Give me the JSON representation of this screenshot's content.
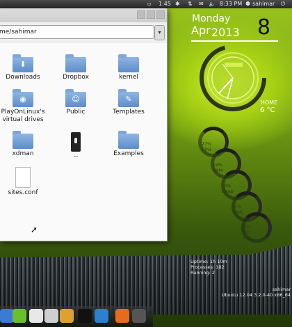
{
  "panel": {
    "time1": "1:45",
    "clock": "8:33 PM",
    "user": "sahimar"
  },
  "window": {
    "address": "me/sahimar",
    "dropdown": "▾",
    "items": [
      {
        "label": "Downloads",
        "icon": "downloads-folder-icon"
      },
      {
        "label": "Dropbox",
        "icon": "folder-icon"
      },
      {
        "label": "kernel",
        "icon": "folder-icon"
      },
      {
        "label": "PlayOnLinux's virtual drives",
        "icon": "playonlinux-folder-icon"
      },
      {
        "label": "Public",
        "icon": "public-folder-icon"
      },
      {
        "label": "Templates",
        "icon": "templates-folder-icon"
      },
      {
        "label": "xdman",
        "icon": "folder-icon"
      },
      {
        "label": "--",
        "icon": "lock-file-icon"
      },
      {
        "label": "Examples",
        "icon": "folder-icon"
      },
      {
        "label": "sites.conf",
        "icon": "text-file-icon"
      }
    ]
  },
  "widget": {
    "day": "Monday",
    "month": "Apr",
    "year": "2013",
    "date": "8",
    "location": "HOME",
    "temp": "6 °C",
    "gauges": [
      {
        "value": "27%",
        "name": "CPU"
      },
      {
        "value": "19%",
        "name": "RAM"
      },
      {
        "value": "0%",
        "name": "Swap"
      },
      {
        "value": "5%",
        "name": "Disk"
      },
      {
        "value": "0D",
        "name": "0U"
      },
      {
        "value": "Net",
        "name": ""
      }
    ],
    "stats_left": [
      "Uptime: 1h 10m",
      "Processes: 182",
      "Running: 2"
    ],
    "stats_right": [
      "sahimar",
      "Ubuntu 12.04 3.2.0-40 x86_64"
    ]
  },
  "colors": {
    "accent": "#a8d214",
    "panel": "#2e2e2e"
  }
}
